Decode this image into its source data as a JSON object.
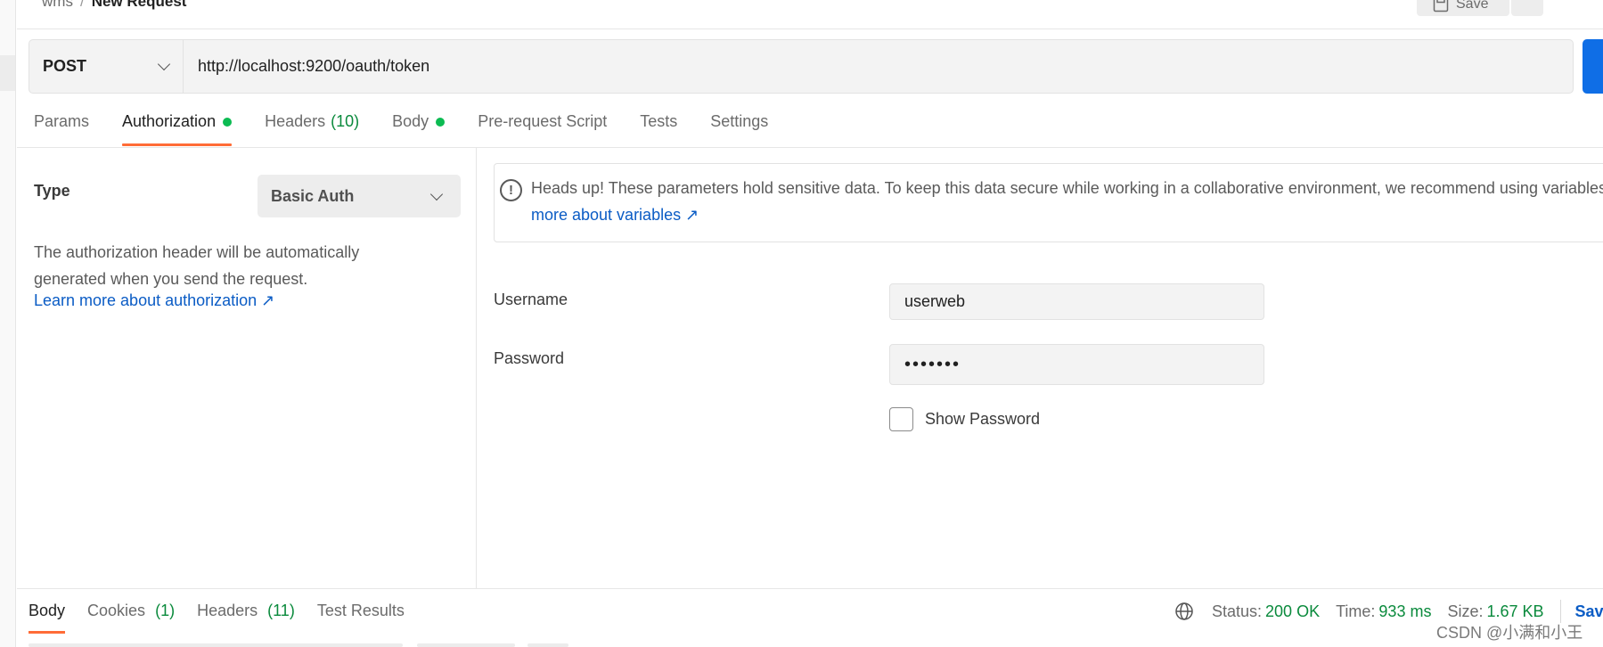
{
  "breadcrumb": {
    "parent": "wms",
    "separator": "/",
    "current": "New Request"
  },
  "topbar": {
    "save_label": "Save"
  },
  "request": {
    "method": "POST",
    "url": "http://localhost:9200/oauth/token"
  },
  "tabs": [
    {
      "label": "Params"
    },
    {
      "label": "Authorization"
    },
    {
      "label": "Headers",
      "count": "(10)"
    },
    {
      "label": "Body"
    },
    {
      "label": "Pre-request Script"
    },
    {
      "label": "Tests"
    },
    {
      "label": "Settings"
    }
  ],
  "auth": {
    "type_label": "Type",
    "type_value": "Basic Auth",
    "description": "The authorization header will be automatically generated when you send the request.",
    "learn_more": "Learn more about authorization ↗",
    "notice_text": "Heads up! These parameters hold sensitive data. To keep this data secure while working in a collaborative environment, we recommend using variables.",
    "notice_link": "Learn more about variables ↗",
    "username_label": "Username",
    "username_value": "userweb",
    "password_label": "Password",
    "password_value": "•••••••",
    "show_password_label": "Show Password"
  },
  "response": {
    "tabs": [
      {
        "label": "Body"
      },
      {
        "label": "Cookies",
        "count": "(1)"
      },
      {
        "label": "Headers",
        "count": "(11)"
      },
      {
        "label": "Test Results"
      }
    ],
    "status_label": "Status:",
    "status_value": "200 OK",
    "time_label": "Time:",
    "time_value": "933 ms",
    "size_label": "Size:",
    "size_value": "1.67 KB",
    "save_label": "Save"
  },
  "watermark": "CSDN @小满和小王",
  "colors": {
    "accent": "#ff6c37",
    "link": "#0b5cc5",
    "success": "#0cbb52",
    "send": "#0f6ee6"
  }
}
